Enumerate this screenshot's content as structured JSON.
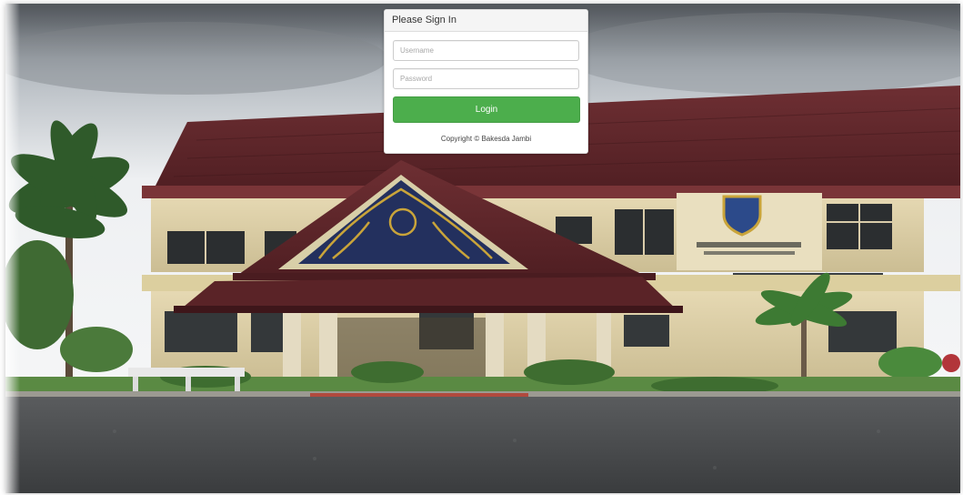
{
  "login": {
    "heading": "Please Sign In",
    "username_placeholder": "Username",
    "password_placeholder": "Password",
    "login_label": "Login",
    "copyright": "Copyright © Bakesda Jambi"
  },
  "colors": {
    "login_button": "#4cae4c",
    "panel_heading_bg": "#f5f5f5"
  }
}
